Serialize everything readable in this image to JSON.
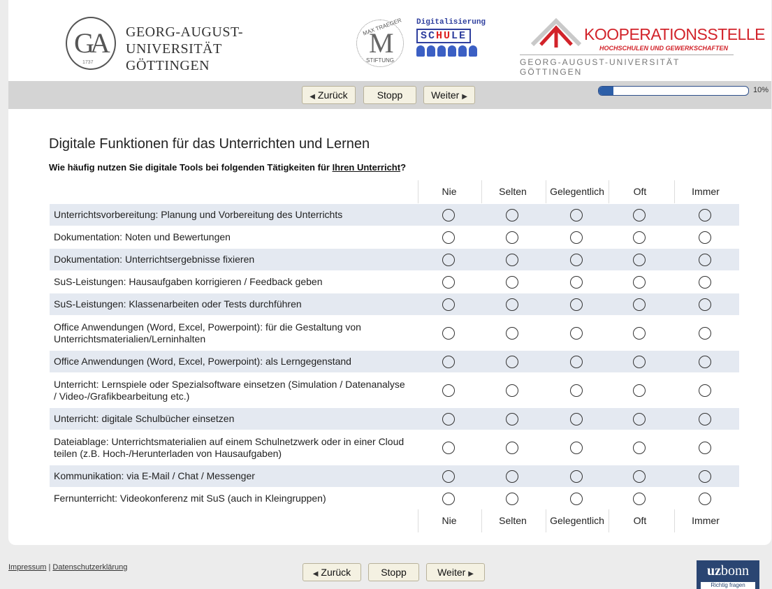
{
  "header": {
    "university_line1": "GEORG-AUGUST-UNIVERSITÄT",
    "university_line2": "GÖTTINGEN",
    "seal_monogram": "GA",
    "seal_year": "1737",
    "mt_top_text": "MAX TRAEGER",
    "mt_bottom_text": "STIFTUNG",
    "ds_title": "Digitalisierung",
    "ds_schule_a": "SC",
    "ds_schule_b": "HU",
    "ds_schule_c": "LE",
    "koop_title": "KOOPERATIONSSTELLE",
    "koop_sub": "HOCHSCHULEN UND GEWERKSCHAFTEN",
    "koop_uni": "GEORG-AUGUST-UNIVERSITÄT GÖTTINGEN"
  },
  "nav": {
    "back_label": "Zurück",
    "stop_label": "Stopp",
    "next_label": "Weiter",
    "progress_fraction": 0.1,
    "progress_label": "10%"
  },
  "page": {
    "title": "Digitale Funktionen für das Unterrichten und Lernen",
    "question_before": "Wie häufig nutzen Sie digitale Tools bei folgenden Tätigkeiten für ",
    "question_underlined": "Ihren Unterricht",
    "question_after": "?"
  },
  "scale": [
    "Nie",
    "Selten",
    "Gelegentlich",
    "Oft",
    "Immer"
  ],
  "items": [
    "Unterrichtsvorbereitung: Planung und Vorbereitung des Unterrichts",
    "Dokumentation: Noten und Bewertungen",
    "Dokumentation: Unterrichtsergebnisse fixieren",
    "SuS-Leistungen: Hausaufgaben korrigieren / Feedback geben",
    "SuS-Leistungen: Klassenarbeiten oder Tests durchführen",
    "Office Anwendungen (Word, Excel, Powerpoint): für die Gestaltung von Unterrichtsmaterialien/Lerninhalten",
    "Office Anwendungen (Word, Excel, Powerpoint): als Lerngegenstand",
    "Unterricht: Lernspiele oder Spezialsoftware einsetzen (Simulation / Datenanalyse / Video-/Grafikbearbeitung etc.)",
    "Unterricht: digitale Schulbücher einsetzen",
    "Dateiablage: Unterrichtsmaterialien auf einem Schulnetzwerk oder in einer Cloud teilen (z.B. Hoch-/Herunterladen von Hausaufgaben)",
    "Kommunikation: via E-Mail / Chat / Messenger",
    "Fernunterricht: Videokonferenz mit SuS (auch in Kleingruppen)"
  ],
  "footer": {
    "impressum": "Impressum",
    "separator": " | ",
    "privacy": "Datenschutzerklärung",
    "brand_bold": "uz",
    "brand_rest": "bonn",
    "brand_tagline": "Richtig fragen"
  }
}
